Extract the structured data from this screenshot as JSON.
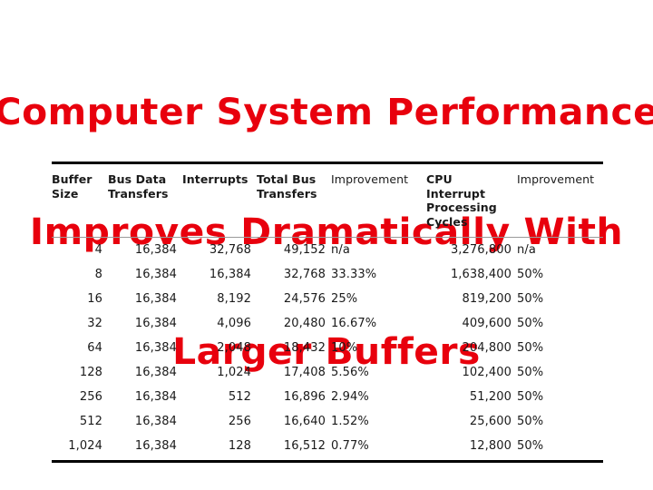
{
  "slide": {
    "title_lines": [
      "Computer System Performance",
      "Improves Dramatically With",
      "Larger Buffers"
    ],
    "title_color": "#e8000d",
    "background_color": "#ffffff"
  },
  "table": {
    "headers": [
      "Buffer Size",
      "Bus Data Transfers",
      "Interrupts",
      "Total Bus Transfers",
      "Improvement",
      "CPU Interrupt Processing Cycles",
      "Improvement"
    ],
    "header_lines": [
      [
        "Buffer",
        "Size"
      ],
      [
        "Bus Data",
        "Transfers"
      ],
      [
        "Interrupts"
      ],
      [
        "Total Bus",
        "Transfers"
      ],
      [
        "Improvement"
      ],
      [
        "CPU",
        "Interrupt",
        "Processing",
        "Cycles"
      ],
      [
        "Improvement"
      ]
    ],
    "rows": [
      {
        "buffer_size": "4",
        "bus_data_transfers": "16,384",
        "interrupts": "32,768",
        "total_bus_transfers": "49,152",
        "improvement_bus": "n/a",
        "cpu_interrupt_cycles": "3,276,800",
        "improvement_cpu": "n/a"
      },
      {
        "buffer_size": "8",
        "bus_data_transfers": "16,384",
        "interrupts": "16,384",
        "total_bus_transfers": "32,768",
        "improvement_bus": "33.33%",
        "cpu_interrupt_cycles": "1,638,400",
        "improvement_cpu": "50%"
      },
      {
        "buffer_size": "16",
        "bus_data_transfers": "16,384",
        "interrupts": "8,192",
        "total_bus_transfers": "24,576",
        "improvement_bus": "25%",
        "cpu_interrupt_cycles": "819,200",
        "improvement_cpu": "50%"
      },
      {
        "buffer_size": "32",
        "bus_data_transfers": "16,384",
        "interrupts": "4,096",
        "total_bus_transfers": "20,480",
        "improvement_bus": "16.67%",
        "cpu_interrupt_cycles": "409,600",
        "improvement_cpu": "50%"
      },
      {
        "buffer_size": "64",
        "bus_data_transfers": "16,384",
        "interrupts": "2,048",
        "total_bus_transfers": "18,432",
        "improvement_bus": "10%",
        "cpu_interrupt_cycles": "204,800",
        "improvement_cpu": "50%"
      },
      {
        "buffer_size": "128",
        "bus_data_transfers": "16,384",
        "interrupts": "1,024",
        "total_bus_transfers": "17,408",
        "improvement_bus": "5.56%",
        "cpu_interrupt_cycles": "102,400",
        "improvement_cpu": "50%"
      },
      {
        "buffer_size": "256",
        "bus_data_transfers": "16,384",
        "interrupts": "512",
        "total_bus_transfers": "16,896",
        "improvement_bus": "2.94%",
        "cpu_interrupt_cycles": "51,200",
        "improvement_cpu": "50%"
      },
      {
        "buffer_size": "512",
        "bus_data_transfers": "16,384",
        "interrupts": "256",
        "total_bus_transfers": "16,640",
        "improvement_bus": "1.52%",
        "cpu_interrupt_cycles": "25,600",
        "improvement_cpu": "50%"
      },
      {
        "buffer_size": "1,024",
        "bus_data_transfers": "16,384",
        "interrupts": "128",
        "total_bus_transfers": "16,512",
        "improvement_bus": "0.77%",
        "cpu_interrupt_cycles": "12,800",
        "improvement_cpu": "50%"
      }
    ]
  },
  "chart_data": {
    "type": "table",
    "title": "Computer System Performance Improves Dramatically With Larger Buffers",
    "columns": [
      "Buffer Size",
      "Bus Data Transfers",
      "Interrupts",
      "Total Bus Transfers",
      "Improvement",
      "CPU Interrupt Processing Cycles",
      "Improvement"
    ],
    "rows": [
      [
        "4",
        "16,384",
        "32,768",
        "49,152",
        "n/a",
        "3,276,800",
        "n/a"
      ],
      [
        "8",
        "16,384",
        "16,384",
        "32,768",
        "33.33%",
        "1,638,400",
        "50%"
      ],
      [
        "16",
        "16,384",
        "8,192",
        "24,576",
        "25%",
        "819,200",
        "50%"
      ],
      [
        "32",
        "16,384",
        "4,096",
        "20,480",
        "16.67%",
        "409,600",
        "50%"
      ],
      [
        "64",
        "16,384",
        "2,048",
        "18,432",
        "10%",
        "204,800",
        "50%"
      ],
      [
        "128",
        "16,384",
        "1,024",
        "17,408",
        "5.56%",
        "102,400",
        "50%"
      ],
      [
        "256",
        "16,384",
        "512",
        "16,896",
        "2.94%",
        "51,200",
        "50%"
      ],
      [
        "512",
        "16,384",
        "256",
        "16,640",
        "1.52%",
        "25,600",
        "50%"
      ],
      [
        "1,024",
        "16,384",
        "128",
        "16,512",
        "0.77%",
        "12,800",
        "50%"
      ]
    ]
  }
}
